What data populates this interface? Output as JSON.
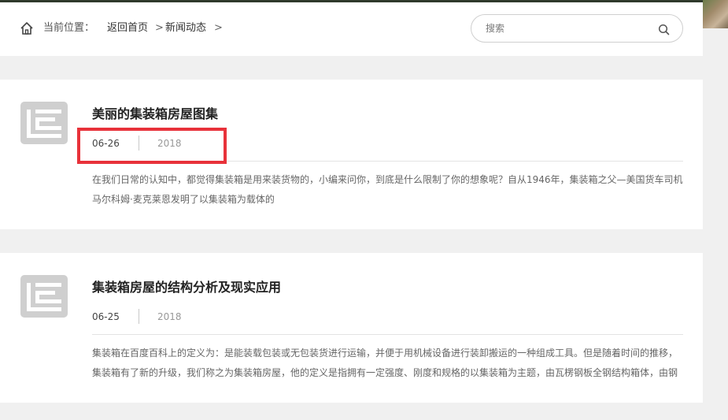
{
  "breadcrumb": {
    "label": "当前位置：",
    "home": "返回首页",
    "sep1": ">",
    "current": "新闻动态",
    "sep2": ">"
  },
  "search": {
    "placeholder": "搜索"
  },
  "articles": [
    {
      "title": "美丽的集装箱房屋图集",
      "date": "06-26",
      "year": "2018",
      "summary": "在我们日常的认知中，都觉得集装箱是用来装货物的，小编来问你，到底是什么限制了你的想象呢？自从1946年，集装箱之父—美国货车司机马尔科姆·麦克莱恩发明了以集装箱为载体的"
    },
    {
      "title": "集装箱房屋的结构分析及现实应用",
      "date": "06-25",
      "year": "2018",
      "summary": "集装箱在百度百科上的定义为：是能装载包装或无包装货进行运输，并便于用机械设备进行装卸搬运的一种组成工具。但是随着时间的推移，集装箱有了新的升级，我们称之为集装箱房屋，他的定义是指拥有一定强度、刚度和规格的以集装箱为主题，由瓦楞钢板全钢结构箱体，由钢"
    }
  ],
  "colors": {
    "highlight": "#e8323a",
    "icon_gray": "#cfcfcf"
  }
}
